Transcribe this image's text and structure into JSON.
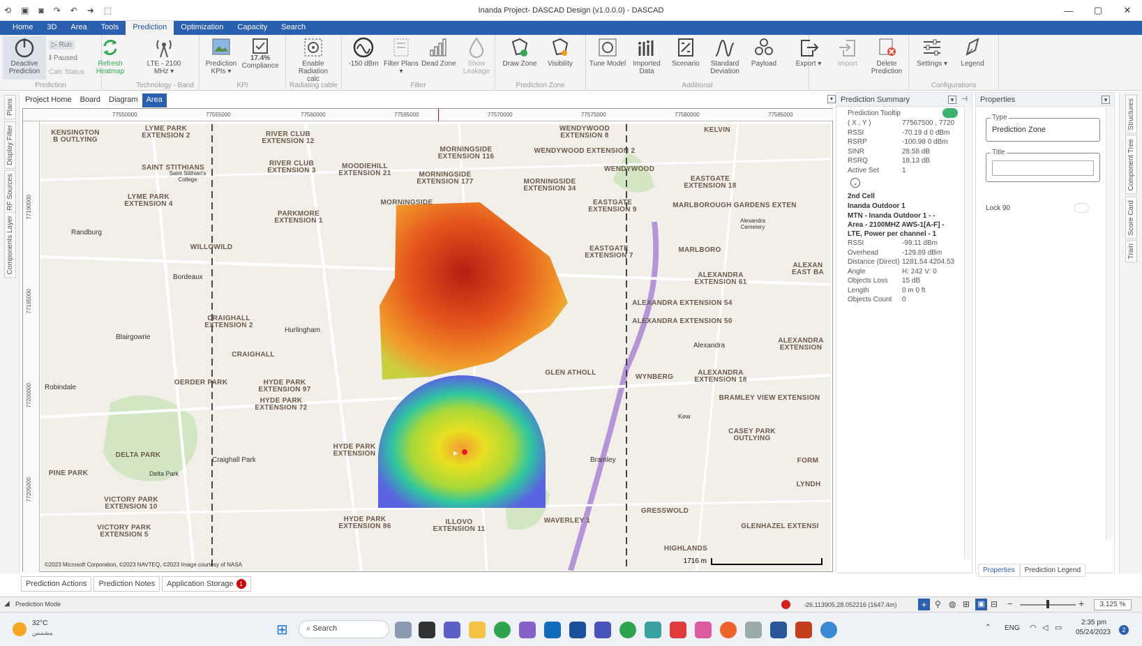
{
  "window": {
    "title": "Inanda Project- DASCAD Design (v1.0.0.0) - DASCAD",
    "minimize": "—",
    "maximize": "▢",
    "close": "✕"
  },
  "menu": [
    "Home",
    "3D",
    "Area",
    "Tools",
    "Prediction",
    "Optimization",
    "Capacity",
    "Search"
  ],
  "ribbon": {
    "groups": {
      "prediction": "Prediction",
      "band": "Technology - Band",
      "kpi": "KPI",
      "radiating": "Radiating cable",
      "filter": "Filter",
      "zone": "Prediction Zone",
      "additional": "Additional",
      "config": "Configurations"
    },
    "deactive": "Deactive Prediction",
    "run": "Run",
    "paused": "Paused",
    "calc_status": "Calc Status",
    "refresh": "Refresh Heatmap",
    "lte": "LTE - 2100 MHz ▾",
    "pred_kpis": "Prediction KPIs ▾",
    "compliance_pct": "17.4%",
    "compliance": "Compliance",
    "enable_rad": "Enable Radiation calc",
    "dbm": "-150 dBm",
    "filter_plans": "Filter Plans ▾",
    "dead_zone": "Dead Zone",
    "show_leakage": "Show Leakage",
    "draw_zone": "Draw Zone",
    "visibility": "Visibility",
    "tune_model": "Tune Model",
    "imported_data": "Imported Data",
    "scenario": "Scenario",
    "std_dev": "Standard Deviation",
    "payload": "Payload",
    "export": "Export ▾",
    "import": "Import",
    "delete_pred": "Delete Prediction",
    "settings": "Settings ▾",
    "legend": "Legend"
  },
  "left_tabs": [
    "Plans",
    "Display Filter",
    "RF Sources",
    "Components Layer"
  ],
  "doc_tabs": [
    "Project Home",
    "Board",
    "Diagram",
    "Area"
  ],
  "ruler": {
    "top": [
      "77550000",
      "77555000",
      "77560000",
      "77565000",
      "77570000",
      "77575000",
      "77580000",
      "77585000"
    ],
    "left": [
      "77190000",
      "77195000",
      "77200000",
      "77205000"
    ]
  },
  "map": {
    "places": [
      "KENSINGTON B OUTLYING",
      "LYME PARK EXTENSION 2",
      "RIVER CLUB EXTENSION 12",
      "WENDYWOOD EXTENSION 8",
      "KELVIN",
      "MORNINGSIDE EXTENSION 116",
      "WENDYWOOD EXTENSION 2",
      "SAINT STITHIANS",
      "RIVER CLUB EXTENSION 3",
      "MOODIEHILL EXTENSION 21",
      "MORNINGSIDE EXTENSION 177",
      "MORNINGSIDE EXTENSION 34",
      "WENDYWOOD",
      "EASTGATE EXTENSION 18",
      "LYME PARK EXTENSION 4",
      "MORNINGSIDE",
      "EASTGATE EXTENSION 9",
      "MARLBOROUGH GARDENS EXTEN",
      "PARKMORE EXTENSION 1",
      "WILLOWILD",
      "MARLBORO",
      "EASTGATE EXTENSION 7",
      "ALEXANDRA EXTENSION 61",
      "ALEXAN EAST BA",
      "ALEXANDRA EXTENSION 54",
      "CRAIGHALL EXTENSION 2",
      "ALEXANDRA EXTENSION 50",
      "ALEXANDRA EXTENSION",
      "WYNBERG",
      "CRAIGHALL",
      "GLEN ATHOLL",
      "ALEXANDRA EXTENSION 18",
      "BRAMLEY VIEW EXTENSION",
      "HYDE PARK EXTENSION 97",
      "HYDE PARK EXTENSION 72",
      "OERDER PARK",
      "HYDE PARK EXTENSION",
      "CASEY PARK OUTLYING",
      "DELTA PARK",
      "PINE PARK",
      "VICTORY PARK EXTENSION 10",
      "VICTORY PARK EXTENSION 5",
      "HYDE PARK EXTENSION 86",
      "ILLOVO EXTENSION 11",
      "WAVERLEY 1",
      "GRESSWOLD",
      "GLENHAZEL EXTENSI",
      "LYNDH",
      "FORM",
      "HIGHLANDS"
    ],
    "towns": [
      "Randburg",
      "Bordeaux",
      "Blairgowrie",
      "Hurlingham",
      "Robindale",
      "Craighall Park",
      "Delta Park",
      "Alexandra",
      "Kew",
      "Bramley",
      "Saint Stithian's College",
      "Alexandra Cemetery"
    ],
    "copyright": "©2023 Microsoft Corporation, ©2023 NAVTEQ, ©2023 Image courtesy of NASA",
    "scale": "1716 m"
  },
  "summary": {
    "title": "Prediction Summary",
    "tooltip": "Prediction Tooltip",
    "rows1": [
      [
        "( X , Y )",
        "77567500 , 7720"
      ],
      [
        "RSSI",
        "-70.19 d  0 dBm"
      ],
      [
        "RSRP",
        "-100.98  0 dBm"
      ],
      [
        "SINR",
        "28.58 dB"
      ],
      [
        "RSRQ",
        "18.13 dB"
      ],
      [
        "Active Set",
        "1"
      ]
    ],
    "second": [
      "2nd Cell",
      "Inanda Outdoor 1",
      "MTN - Inanda Outdoor 1 - -",
      "Area - 2100MHZ AWS-1[A-F] -",
      "LTE, Power per channel - 1"
    ],
    "rows2": [
      [
        "RSSI",
        "-99.11 dBm"
      ],
      [
        "Overhead",
        "-129.89 dBm"
      ],
      [
        "Distance (Direct)",
        "1281.54  4204.53"
      ],
      [
        "Angle",
        "H: 242   V: 0"
      ],
      [
        "Objects Loss",
        "15 dB"
      ],
      [
        "Length",
        "0 m      0 ft"
      ],
      [
        "Objects Count",
        "0"
      ]
    ]
  },
  "properties": {
    "title": "Properties",
    "type_label": "Type",
    "type_value": "Prediction Zone",
    "title_label": "Title",
    "lock": "Lock 90",
    "tabs": [
      "Properties",
      "Prediction Legend"
    ]
  },
  "right_tabs": [
    "Structures",
    "Component Tree",
    "Score Card",
    "Train"
  ],
  "bottom_tabs": [
    "Prediction Actions",
    "Prediction Notes",
    "Application Storage"
  ],
  "storage_badge": "1",
  "status": {
    "mode": "Prediction Mode",
    "coords": "-26.113905,28.052216  (1647.4m)",
    "zoom": "3.125 %"
  },
  "taskbar": {
    "temp": "32°C",
    "weather": "مشمس",
    "search": "Search",
    "lang": "ENG",
    "time": "2:35 pm",
    "date": "05/24/2023"
  },
  "colors": {
    "accent": "#2b5fb0",
    "active_toggle": "#3cb371"
  }
}
